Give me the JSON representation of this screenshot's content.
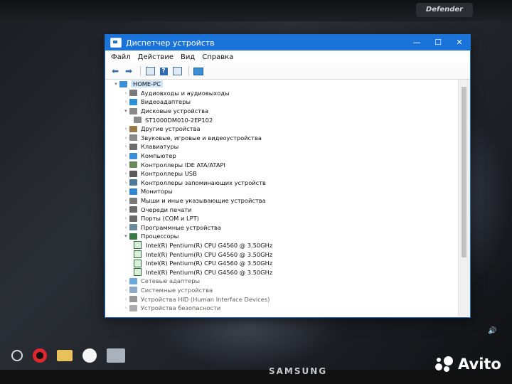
{
  "window": {
    "title": "Диспетчер устройств",
    "controls": {
      "minimize": "—",
      "maximize": "☐",
      "close": "✕"
    }
  },
  "menu": [
    "Файл",
    "Действие",
    "Вид",
    "Справка"
  ],
  "toolbar": {
    "back_icon": "arrow-left-icon",
    "forward_icon": "arrow-right-icon"
  },
  "tree": {
    "root": "HOME-PC",
    "categories": [
      {
        "label": "Аудиовходы и аудиовыходы",
        "icon_color": "#7a7a7a",
        "expanded": false
      },
      {
        "label": "Видеоадаптеры",
        "icon_color": "#2a8fd9",
        "expanded": false
      },
      {
        "label": "Дисковые устройства",
        "icon_color": "#8a8a8a",
        "expanded": true,
        "children": [
          "ST1000DM010-2EP102"
        ]
      },
      {
        "label": "Другие устройства",
        "icon_color": "#9a7a4a",
        "expanded": false
      },
      {
        "label": "Звуковые, игровые и видеоустройства",
        "icon_color": "#8a8a8a",
        "expanded": false
      },
      {
        "label": "Клавиатуры",
        "icon_color": "#6d6d6d",
        "expanded": false
      },
      {
        "label": "Компьютер",
        "icon_color": "#3b8fd6",
        "expanded": false
      },
      {
        "label": "Контроллеры IDE ATA/ATAPI",
        "icon_color": "#6b8a5a",
        "expanded": false
      },
      {
        "label": "Контроллеры USB",
        "icon_color": "#5a5a5a",
        "expanded": false
      },
      {
        "label": "Контроллеры запоминающих устройств",
        "icon_color": "#4d7a9a",
        "expanded": false
      },
      {
        "label": "Мониторы",
        "icon_color": "#2f86d2",
        "expanded": false
      },
      {
        "label": "Мыши и иные указывающие устройства",
        "icon_color": "#7a7a7a",
        "expanded": false
      },
      {
        "label": "Очереди печати",
        "icon_color": "#6a6a6a",
        "expanded": false
      },
      {
        "label": "Порты (COM и LPT)",
        "icon_color": "#6a6a6a",
        "expanded": false
      },
      {
        "label": "Программные устройства",
        "icon_color": "#6a8aa0",
        "expanded": false
      },
      {
        "label": "Процессоры",
        "icon_color": "#3a7a46",
        "expanded": true,
        "children": [
          "Intel(R) Pentium(R) CPU G4560 @ 3.50GHz",
          "Intel(R) Pentium(R) CPU G4560 @ 3.50GHz",
          "Intel(R) Pentium(R) CPU G4560 @ 3.50GHz",
          "Intel(R) Pentium(R) CPU G4560 @ 3.50GHz"
        ]
      },
      {
        "label": "Сетевые адаптеры",
        "icon_color": "#2f86d2",
        "expanded": false
      },
      {
        "label": "Системные устройства",
        "icon_color": "#5c86b0",
        "expanded": false
      },
      {
        "label": "Устройства HID (Human Interface Devices)",
        "icon_color": "#6a6a6a",
        "expanded": false
      },
      {
        "label": "Устройства безопасности",
        "icon_color": "#8a8a8a",
        "expanded": false
      }
    ]
  },
  "monitor_brand": "SAMSUNG",
  "keyboard_brand": "Defender",
  "watermark": "Avito"
}
